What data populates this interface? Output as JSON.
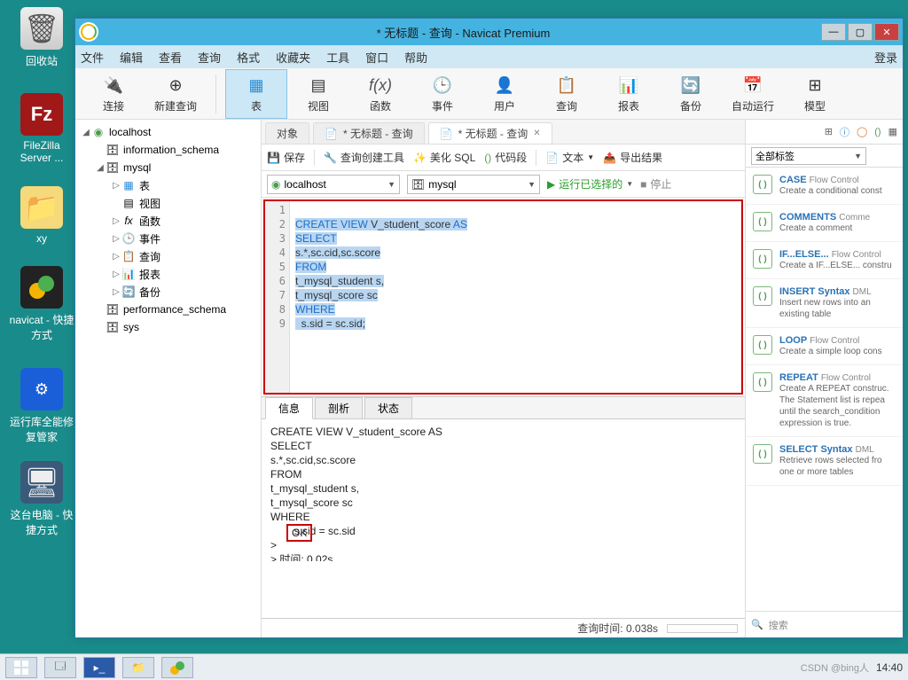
{
  "desktop": {
    "recycle": "回收站",
    "filezilla": "FileZilla Server ...",
    "xy": "xy",
    "navicat": "navicat - 快捷方式",
    "fixer": "运行库全能修复管家",
    "pc": "这台电脑 - 快捷方式"
  },
  "window": {
    "title": "* 无标题 - 查询 - Navicat Premium"
  },
  "menu": [
    "文件",
    "编辑",
    "查看",
    "查询",
    "格式",
    "收藏夹",
    "工具",
    "窗口",
    "帮助"
  ],
  "menu_right": "登录",
  "tools": {
    "connect": "连接",
    "newquery": "新建查询",
    "table": "表",
    "view": "视图",
    "func": "函数",
    "event": "事件",
    "user": "用户",
    "query": "查询",
    "report": "报表",
    "backup": "备份",
    "auto": "自动运行",
    "model": "模型"
  },
  "tree": {
    "localhost": "localhost",
    "info_schema": "information_schema",
    "mysql": "mysql",
    "table": "表",
    "view": "视图",
    "func": "函数",
    "event": "事件",
    "query": "查询",
    "report": "报表",
    "backup": "备份",
    "perf": "performance_schema",
    "sys": "sys"
  },
  "tabs": {
    "obj": "对象",
    "q1": "* 无标题 - 查询",
    "q2": "* 无标题 - 查询"
  },
  "qbar": {
    "save": "保存",
    "builder": "查询创建工具",
    "beautify": "美化 SQL",
    "snippet": "代码段",
    "text": "文本",
    "export": "导出结果"
  },
  "selrow": {
    "conn": "localhost",
    "db": "mysql",
    "run": "运行已选择的",
    "stop": "停止"
  },
  "sql_lines": [
    "",
    "CREATE VIEW V_student_score AS",
    "SELECT",
    "s.*,sc.cid,sc.score",
    "FROM",
    "t_mysql_student s,",
    "t_mysql_score sc",
    "WHERE",
    "  s.sid = sc.sid;"
  ],
  "btabs": {
    "info": "信息",
    "analyze": "剖析",
    "status": "状态"
  },
  "msg": {
    "l1": "CREATE VIEW V_student_score AS",
    "l2": "SELECT",
    "l3": "s.*,sc.cid,sc.score",
    "l4": "FROM",
    "l5": "t_mysql_student s,",
    "l6": "t_mysql_score sc",
    "l7": "WHERE",
    "l8": "        s.sid = sc.sid",
    "ok": "OK",
    "prefix": "> ",
    "time": "> 时间: 0.02s"
  },
  "status": {
    "query_time": "查询时间: 0.038s"
  },
  "rp": {
    "tags": "全部标签",
    "search": "搜索",
    "items": [
      {
        "t": "CASE",
        "s": "Flow Control",
        "d": "Create a conditional const"
      },
      {
        "t": "COMMENTS",
        "s": "Comme",
        "d": "Create a comment"
      },
      {
        "t": "IF...ELSE...",
        "s": "Flow Control",
        "d": "Create a IF...ELSE... constru"
      },
      {
        "t": "INSERT Syntax",
        "s": "DML",
        "d": "Insert new rows into an existing table"
      },
      {
        "t": "LOOP",
        "s": "Flow Control",
        "d": "Create a simple loop cons"
      },
      {
        "t": "REPEAT",
        "s": "Flow Control",
        "d": "Create A REPEAT construc. The Statement list is repea until the search_condition expression is true."
      },
      {
        "t": "SELECT Syntax",
        "s": "DML",
        "d": "Retrieve rows selected fro one or more tables"
      }
    ]
  },
  "taskbar": {
    "watermark": "CSDN @bing人",
    "clock": "14:40"
  }
}
